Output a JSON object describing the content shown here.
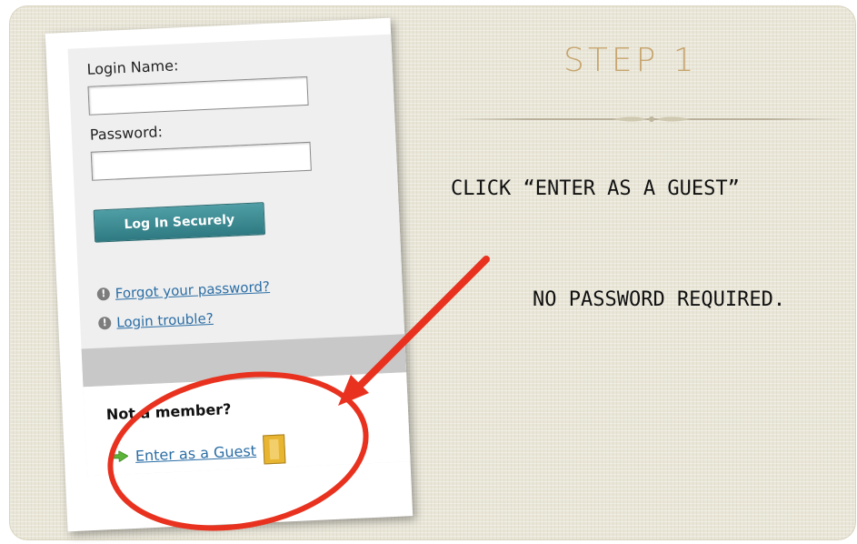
{
  "slide": {
    "step_title": "STEP 1",
    "instruction": "CLICK “ENTER AS A GUEST”",
    "note": "NO PASSWORD REQUIRED."
  },
  "login": {
    "login_name_label": "Login Name:",
    "login_name_value": "",
    "password_label": "Password:",
    "password_value": "",
    "submit_label": "Log In Securely",
    "forgot_password": "Forgot your password?",
    "login_trouble": "Login trouble?",
    "not_member": "Not a member?",
    "guest_link": "Enter as a Guest"
  },
  "icons": {
    "help": "info-icon",
    "arrow": "green-arrow-icon",
    "door": "door-icon"
  },
  "colors": {
    "accent_title": "#c7a56f",
    "button": "#3a8a92",
    "link": "#2b6ea5",
    "annotation": "#e8321f"
  }
}
